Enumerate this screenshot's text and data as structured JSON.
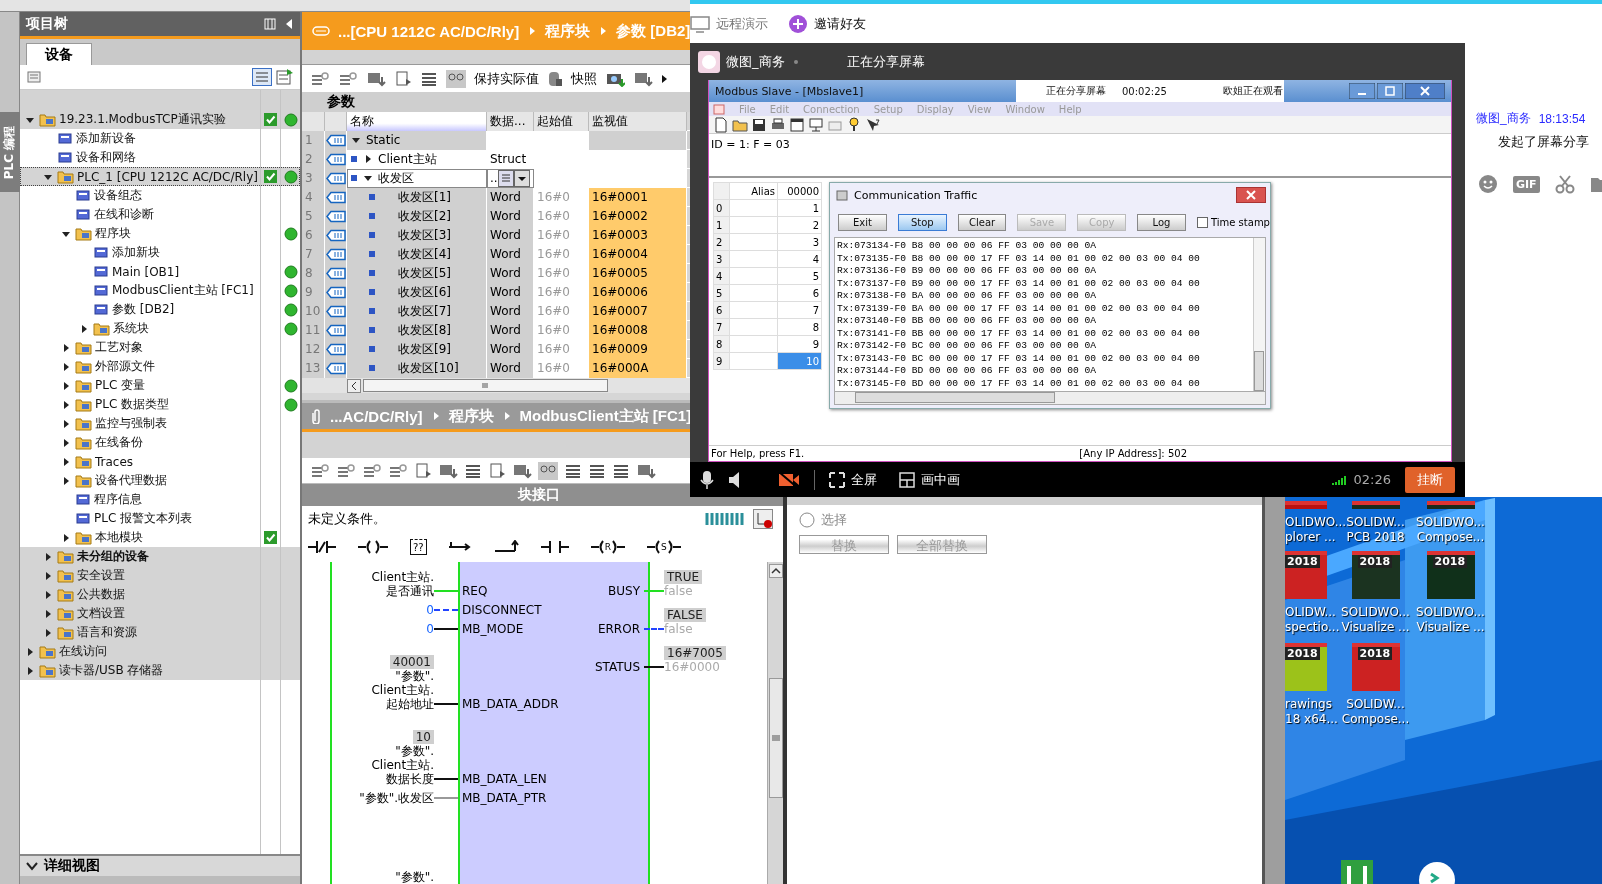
{
  "tia_portal": {
    "side_tab": {
      "label": "PLC 编程"
    },
    "project_tree": {
      "title": "项目树",
      "tab": {
        "label": "设备",
        "selected": true
      },
      "items": [
        {
          "label": "19.23.1.ModbusTCP通讯实验",
          "kind": "group",
          "expanded": true,
          "selected": false,
          "consistent": true,
          "online": true,
          "children": [
            {
              "label": "添加新设备",
              "kind": "leaf",
              "selected": false
            },
            {
              "label": "设备和网络",
              "kind": "leaf",
              "selected": false
            },
            {
              "label": "PLC_1 [CPU 1212C AC/DC/Rly]",
              "kind": "group",
              "expanded": true,
              "selected": true,
              "consistent": true,
              "online": true,
              "children": [
                {
                  "label": "设备组态",
                  "kind": "leaf",
                  "selected": false
                },
                {
                  "label": "在线和诊断",
                  "kind": "leaf",
                  "selected": false
                },
                {
                  "label": "程序块",
                  "kind": "group",
                  "expanded": true,
                  "selected": false,
                  "online": true,
                  "children": [
                    {
                      "label": "添加新块",
                      "kind": "leaf",
                      "selected": false
                    },
                    {
                      "label": "Main [OB1]",
                      "kind": "leaf",
                      "selected": false,
                      "online": true
                    },
                    {
                      "label": "ModbusClient主站 [FC1]",
                      "kind": "leaf",
                      "selected": false,
                      "online": true
                    },
                    {
                      "label": "参数 [DB2]",
                      "kind": "leaf",
                      "selected": false,
                      "online": true
                    },
                    {
                      "label": "系统块",
                      "kind": "group",
                      "expanded": false,
                      "selected": false,
                      "online": true
                    }
                  ]
                },
                {
                  "label": "工艺对象",
                  "kind": "group",
                  "expanded": false,
                  "selected": false
                },
                {
                  "label": "外部源文件",
                  "kind": "group",
                  "expanded": false,
                  "selected": false
                },
                {
                  "label": "PLC 变量",
                  "kind": "group",
                  "expanded": false,
                  "selected": false,
                  "online": true
                },
                {
                  "label": "PLC 数据类型",
                  "kind": "group",
                  "expanded": false,
                  "selected": false,
                  "online": true
                },
                {
                  "label": "监控与强制表",
                  "kind": "group",
                  "expanded": false,
                  "selected": false
                },
                {
                  "label": "在线备份",
                  "kind": "group",
                  "expanded": false,
                  "selected": false
                },
                {
                  "label": "Traces",
                  "kind": "group",
                  "expanded": false,
                  "selected": false
                },
                {
                  "label": "设备代理数据",
                  "kind": "group",
                  "expanded": false,
                  "selected": false
                },
                {
                  "label": "程序信息",
                  "kind": "leaf",
                  "selected": false
                },
                {
                  "label": "PLC 报警文本列表",
                  "kind": "leaf",
                  "selected": false
                },
                {
                  "label": "本地模块",
                  "kind": "group",
                  "expanded": false,
                  "selected": false,
                  "consistent": true
                }
              ]
            },
            {
              "label": "未分组的设备",
              "kind": "group",
              "expanded": false,
              "selected": false,
              "bold": true
            },
            {
              "label": "安全设置",
              "kind": "group",
              "expanded": false,
              "selected": false
            },
            {
              "label": "公共数据",
              "kind": "group",
              "expanded": false,
              "selected": false
            },
            {
              "label": "文档设置",
              "kind": "group",
              "expanded": false,
              "selected": false
            },
            {
              "label": "语言和资源",
              "kind": "group",
              "expanded": false,
              "selected": false
            }
          ]
        },
        {
          "label": "在线访问",
          "kind": "group",
          "expanded": false,
          "selected": false
        },
        {
          "label": "读卡器/USB 存储器",
          "kind": "group",
          "expanded": false,
          "selected": false
        }
      ]
    },
    "detail_view": {
      "title": "详细视图"
    },
    "db_editor": {
      "breadcrumb": [
        "...[CPU 1212C AC/DC/Rly]",
        "程序块",
        "参数 [DB2]"
      ],
      "toolbar": [
        "保持实际值",
        "快照"
      ],
      "title": "参数",
      "columns": [
        "名称",
        "数据...",
        "起始值",
        "监视值"
      ],
      "rows": [
        {
          "num": "1",
          "name": "Static",
          "expanded": true,
          "children": [
            {
              "num": "2",
              "name": "Client主站",
              "type": "Struct",
              "expanded": false
            },
            {
              "num": "3",
              "name": "收发区",
              "type": "..",
              "expanded": true,
              "editing": true,
              "children": [
                {
                  "num": "4",
                  "name": "收发区[1]",
                  "type": "Word",
                  "start": "16#0",
                  "monitor": "16#0001"
                },
                {
                  "num": "5",
                  "name": "收发区[2]",
                  "type": "Word",
                  "start": "16#0",
                  "monitor": "16#0002"
                },
                {
                  "num": "6",
                  "name": "收发区[3]",
                  "type": "Word",
                  "start": "16#0",
                  "monitor": "16#0003"
                },
                {
                  "num": "7",
                  "name": "收发区[4]",
                  "type": "Word",
                  "start": "16#0",
                  "monitor": "16#0004"
                },
                {
                  "num": "8",
                  "name": "收发区[5]",
                  "type": "Word",
                  "start": "16#0",
                  "monitor": "16#0005"
                },
                {
                  "num": "9",
                  "name": "收发区[6]",
                  "type": "Word",
                  "start": "16#0",
                  "monitor": "16#0006"
                },
                {
                  "num": "10",
                  "name": "收发区[7]",
                  "type": "Word",
                  "start": "16#0",
                  "monitor": "16#0007"
                },
                {
                  "num": "11",
                  "name": "收发区[8]",
                  "type": "Word",
                  "start": "16#0",
                  "monitor": "16#0008"
                },
                {
                  "num": "12",
                  "name": "收发区[9]",
                  "type": "Word",
                  "start": "16#0",
                  "monitor": "16#0009"
                },
                {
                  "num": "13",
                  "name": "收发区[10]",
                  "type": "Word",
                  "start": "16#0",
                  "monitor": "16#000A"
                }
              ]
            }
          ]
        }
      ]
    },
    "fc_editor": {
      "breadcrumb": [
        "...AC/DC/Rly]",
        "程序块",
        "ModbusClient主站 [FC1]"
      ],
      "interface_bar": "块接口",
      "condition": "未定义条件。",
      "instructions": [
        {
          "kind": "nc_contact"
        },
        {
          "kind": "coil"
        },
        {
          "kind": "box",
          "label": "??"
        },
        {
          "kind": "branch_open"
        },
        {
          "kind": "branch_close"
        },
        {
          "kind": "no_contact"
        },
        {
          "kind": "coil",
          "label": "R"
        },
        {
          "kind": "coil",
          "label": "S"
        }
      ],
      "inputs": [
        {
          "pin": "REQ",
          "operand": [
            "Client主站.",
            "是否通讯"
          ],
          "kind": "bool_true"
        },
        {
          "pin": "DISCONNECT",
          "operand": [
            "0"
          ],
          "constant": true,
          "kind": "bool_false"
        },
        {
          "pin": "MB_MODE",
          "operand": [
            "0"
          ],
          "constant": true,
          "kind": "value"
        },
        {
          "pin": "MB_DATA_ADDR",
          "monitor": "40001",
          "operand": [
            "\"参数\".",
            "Client主站.",
            "起始地址"
          ],
          "kind": "value"
        },
        {
          "pin": "MB_DATA_LEN",
          "monitor": "10",
          "operand": [
            "\"参数\".",
            "Client主站.",
            "数据长度"
          ],
          "kind": "value"
        },
        {
          "pin": "MB_DATA_PTR",
          "operand": [
            "\"参数\".收发区"
          ],
          "kind": "pointer"
        }
      ],
      "next_operand": "\"参数\".",
      "outputs": [
        {
          "pin": "BUSY",
          "monitor": "TRUE",
          "operand": "false",
          "kind": "bool_true"
        },
        {
          "pin": "ERROR",
          "monitor": "FALSE",
          "operand": "false",
          "kind": "bool_false"
        },
        {
          "pin": "STATUS",
          "monitor": "16#7005",
          "operand": "16#0000",
          "kind": "value"
        }
      ]
    },
    "replace_panel": {
      "radio": {
        "label": "选择",
        "selected": false
      },
      "buttons": [
        {
          "label": "替换",
          "disabled": true
        },
        {
          "label": "全部替换",
          "disabled": true
        }
      ]
    }
  },
  "desktop": {
    "icons": [
      {
        "lines": [
          "OLIDWO...",
          "plorer ..."
        ]
      },
      {
        "lines": [
          "SOLIDW...",
          "PCB 2018"
        ]
      },
      {
        "lines": [
          "SOLIDWO...",
          "Compose..."
        ]
      },
      {
        "lines": [
          "OLIDW...",
          "spectio..."
        ],
        "badge": "2018"
      },
      {
        "lines": [
          "SOLIDWO...",
          "Visualize ..."
        ],
        "badge": "2018"
      },
      {
        "lines": [
          "SOLIDWO...",
          "Visualize ..."
        ],
        "badge": "2018"
      },
      {
        "lines": [
          "rawings",
          "18 x64..."
        ],
        "badge": "2018"
      },
      {
        "lines": [
          "SOLIDW...",
          "Compose..."
        ],
        "badge": "2018"
      }
    ]
  },
  "chat": {
    "sender": "微图_商务",
    "time": "18:13:54",
    "message": "发起了屏幕分享",
    "gif_label": "GIF"
  },
  "top_bar": {
    "items": [
      "远程演示",
      "邀请好友"
    ]
  },
  "share_window": {
    "user": "微图_商务",
    "status": "正在分享屏幕",
    "notice": {
      "label": "正在分享屏幕",
      "time": "00:02:25",
      "viewers": "欧姐正在观看"
    },
    "modbus_slave": {
      "title": "Modbus Slave - [Mbslave1]",
      "menu": [
        "File",
        "Edit",
        "Connection",
        "Setup",
        "Display",
        "View",
        "Window",
        "Help"
      ],
      "id_line": "ID = 1: F = 03",
      "table": {
        "columns": [
          "Alias",
          "00000"
        ],
        "rows": [
          {
            "index": "0",
            "value": "1",
            "selected": false
          },
          {
            "index": "1",
            "value": "2",
            "selected": false
          },
          {
            "index": "2",
            "value": "3",
            "selected": false
          },
          {
            "index": "3",
            "value": "4",
            "selected": false
          },
          {
            "index": "4",
            "value": "5",
            "selected": false
          },
          {
            "index": "5",
            "value": "6",
            "selected": false
          },
          {
            "index": "6",
            "value": "7",
            "selected": false
          },
          {
            "index": "7",
            "value": "8",
            "selected": false
          },
          {
            "index": "8",
            "value": "9",
            "selected": false
          },
          {
            "index": "9",
            "value": "10",
            "selected": true
          }
        ]
      },
      "traffic": {
        "title": "Communication Traffic",
        "buttons": [
          {
            "label": "Exit",
            "disabled": false
          },
          {
            "label": "Stop",
            "disabled": false,
            "focused": true
          },
          {
            "label": "Clear",
            "disabled": false
          },
          {
            "label": "Save",
            "disabled": true
          },
          {
            "label": "Copy",
            "disabled": true
          },
          {
            "label": "Log",
            "disabled": false
          }
        ],
        "timestamp": {
          "label": "Time stamp",
          "checked": false
        },
        "lines": [
          "Rx:073134-F0 B8 00 00 00 06 FF 03 00 00 00 0A",
          "Tx:073135-F0 B8 00 00 00 17 FF 03 14 00 01 00 02 00 03 00 04 00",
          "Rx:073136-F0 B9 00 00 00 06 FF 03 00 00 00 0A",
          "Tx:073137-F0 B9 00 00 00 17 FF 03 14 00 01 00 02 00 03 00 04 00",
          "Rx:073138-F0 BA 00 00 00 06 FF 03 00 00 00 0A",
          "Tx:073139-F0 BA 00 00 00 17 FF 03 14 00 01 00 02 00 03 00 04 00",
          "Rx:073140-F0 BB 00 00 00 06 FF 03 00 00 00 0A",
          "Tx:073141-F0 BB 00 00 00 17 FF 03 14 00 01 00 02 00 03 00 04 00",
          "Rx:073142-F0 BC 00 00 00 06 FF 03 00 00 00 0A",
          "Tx:073143-F0 BC 00 00 00 17 FF 03 14 00 01 00 02 00 03 00 04 00",
          "Rx:073144-F0 BD 00 00 00 06 FF 03 00 00 00 0A",
          "Tx:073145-F0 BD 00 00 00 17 FF 03 14 00 01 00 02 00 03 00 04 00"
        ]
      },
      "status_left": "For Help, press F1.",
      "status_right": "[Any IP Address]: 502"
    },
    "controls": {
      "camera_on": false,
      "fullscreen": "全屏",
      "pip": "画中画",
      "timer": "02:26",
      "hangup": "挂断"
    }
  }
}
